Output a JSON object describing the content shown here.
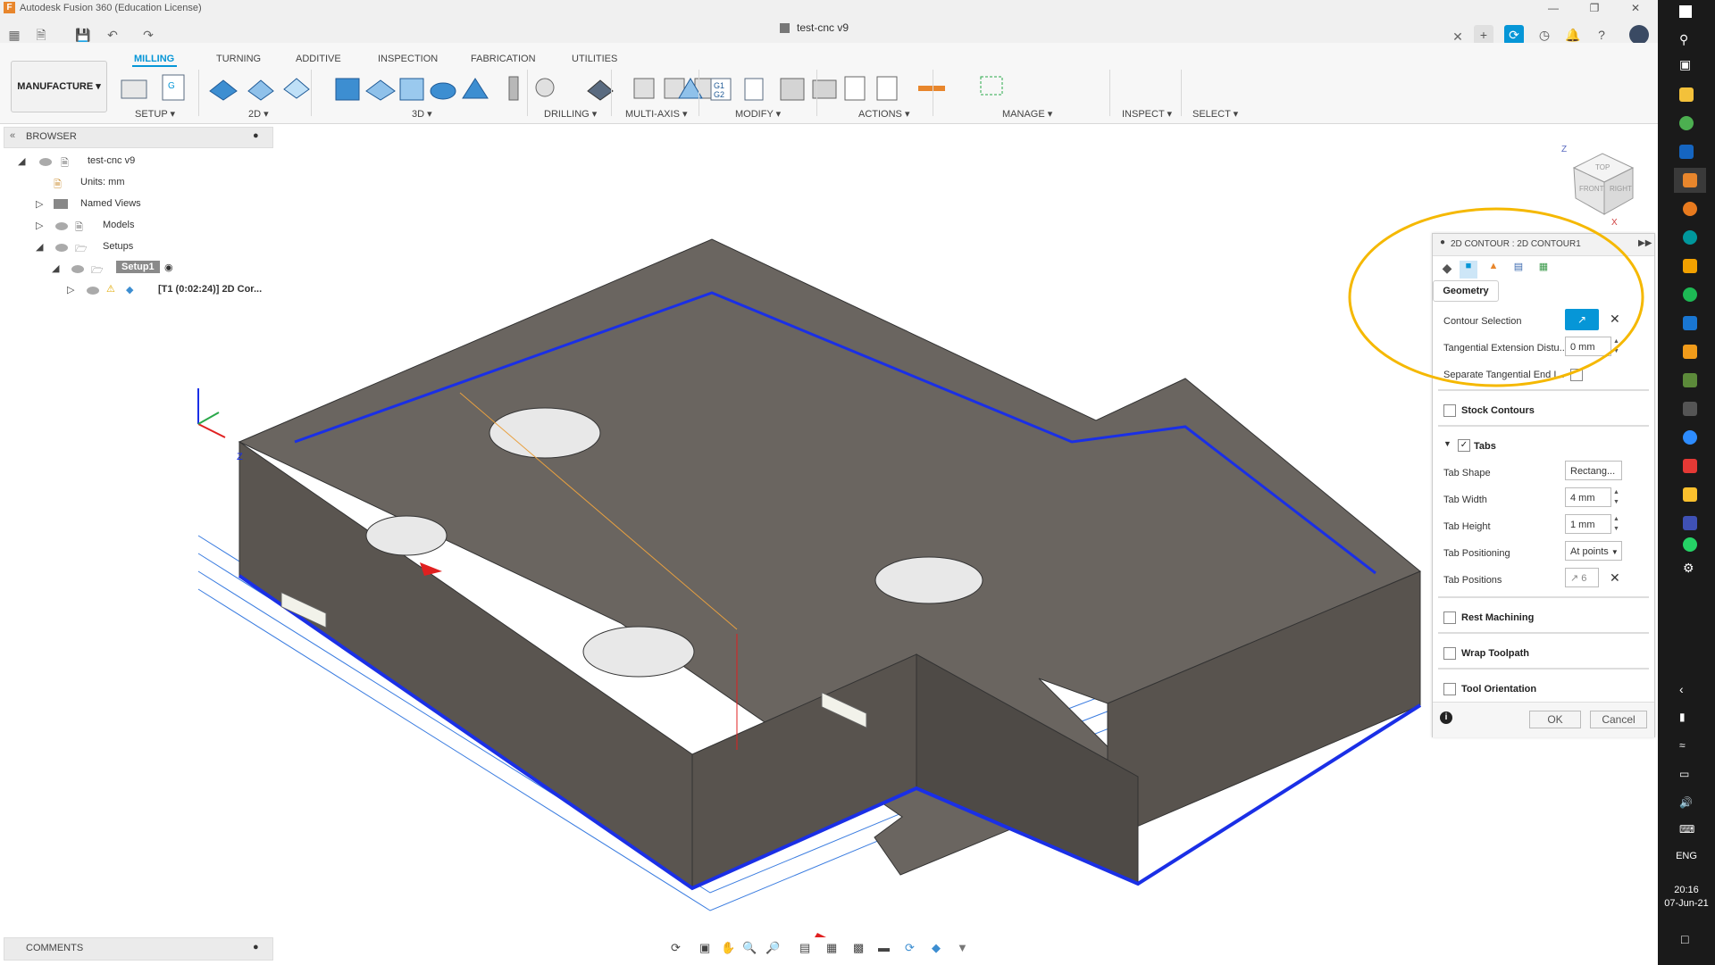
{
  "app": {
    "title": "Autodesk Fusion 360 (Education License)",
    "document_tab": "test-cnc v9",
    "icon_letter": "F"
  },
  "ribbon": {
    "workspace": "MANUFACTURE",
    "tabs": [
      "MILLING",
      "TURNING",
      "ADDITIVE",
      "INSPECTION",
      "FABRICATION",
      "UTILITIES"
    ],
    "active_tab": "MILLING",
    "groups": [
      "SETUP",
      "2D",
      "3D",
      "DRILLING",
      "MULTI-AXIS",
      "MODIFY",
      "ACTIONS",
      "MANAGE",
      "INSPECT",
      "SELECT"
    ]
  },
  "browser": {
    "header": "BROWSER",
    "root": "test-cnc v9",
    "units": "Units: mm",
    "named_views": "Named Views",
    "models": "Models",
    "setups": "Setups",
    "setup1": "Setup1",
    "operation": "[T1 (0:02:24)] 2D Cor..."
  },
  "comments": {
    "label": "COMMENTS"
  },
  "viewcube": {
    "top": "TOP",
    "front": "FRONT",
    "right": "RIGHT",
    "z": "Z",
    "x": "X"
  },
  "panel": {
    "title": "2D CONTOUR : 2D CONTOUR1",
    "geometry_tab": "Geometry",
    "contour_selection_label": "Contour Selection",
    "tangential_extension_label": "Tangential Extension Distu...",
    "tangential_extension_value": "0 mm",
    "separate_tangential_label": "Separate Tangential End I...",
    "stock_contours": "Stock Contours",
    "tabs_section": "Tabs",
    "tab_shape_label": "Tab Shape",
    "tab_shape_value": "Rectang...",
    "tab_width_label": "Tab Width",
    "tab_width_value": "4 mm",
    "tab_height_label": "Tab Height",
    "tab_height_value": "1 mm",
    "tab_positioning_label": "Tab Positioning",
    "tab_positioning_value": "At points",
    "tab_positions_label": "Tab Positions",
    "tab_positions_value": "6",
    "rest_machining": "Rest Machining",
    "wrap_toolpath": "Wrap Toolpath",
    "tool_orientation": "Tool Orientation",
    "ok": "OK",
    "cancel": "Cancel",
    "tabs_checked": true,
    "accent": "#0696d7",
    "highlight_ring": "#f5b800"
  },
  "axis": {
    "z": "Z"
  },
  "taskbar": {
    "lang": "ENG",
    "time": "20:16",
    "date": "07-Jun-21"
  }
}
